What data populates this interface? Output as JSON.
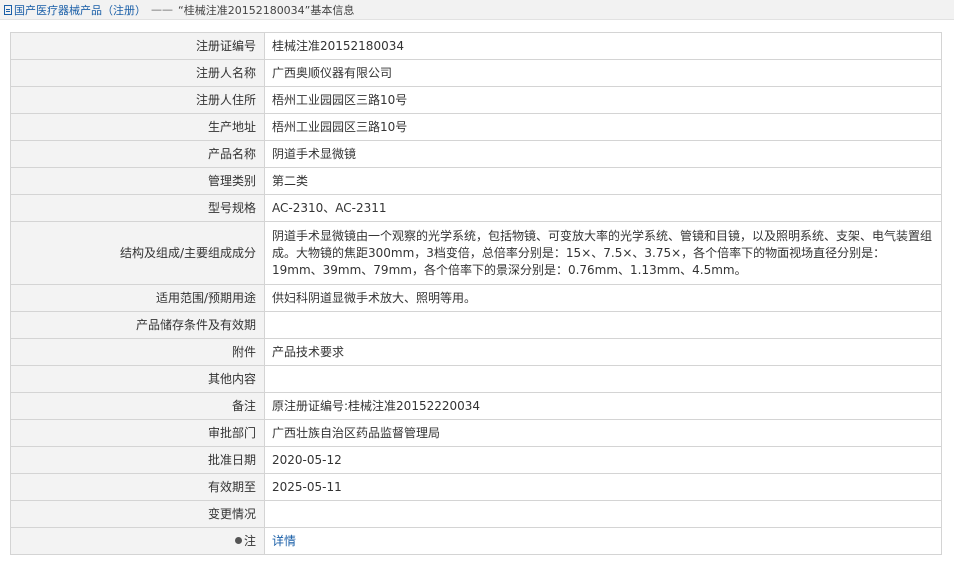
{
  "breadcrumb": {
    "root": "国产医疗器械产品（注册）",
    "separator": "——",
    "current": "“桂械注准20152180034”基本信息"
  },
  "rows": [
    {
      "label": "注册证编号",
      "value": "桂械注准20152180034"
    },
    {
      "label": "注册人名称",
      "value": "广西奥顺仪器有限公司"
    },
    {
      "label": "注册人住所",
      "value": "梧州工业园园区三路10号"
    },
    {
      "label": "生产地址",
      "value": "梧州工业园园区三路10号"
    },
    {
      "label": "产品名称",
      "value": "阴道手术显微镜"
    },
    {
      "label": "管理类别",
      "value": "第二类"
    },
    {
      "label": "型号规格",
      "value": "AC-2310、AC-2311"
    },
    {
      "label": "结构及组成/主要组成成分",
      "value": "阴道手术显微镜由一个观察的光学系统，包括物镜、可变放大率的光学系统、管镜和目镜，以及照明系统、支架、电气装置组成。大物镜的焦距300mm，3档变倍，总倍率分别是：15×、7.5×、3.75×，各个倍率下的物面视场直径分别是：19mm、39mm、79mm，各个倍率下的景深分别是：0.76mm、1.13mm、4.5mm。"
    },
    {
      "label": "适用范围/预期用途",
      "value": "供妇科阴道显微手术放大、照明等用。"
    },
    {
      "label": "产品储存条件及有效期",
      "value": ""
    },
    {
      "label": "附件",
      "value": "产品技术要求"
    },
    {
      "label": "其他内容",
      "value": ""
    },
    {
      "label": "备注",
      "value": "原注册证编号:桂械注准20152220034"
    },
    {
      "label": "审批部门",
      "value": "广西壮族自治区药品监督管理局"
    },
    {
      "label": "批准日期",
      "value": "2020-05-12"
    },
    {
      "label": "有效期至",
      "value": "2025-05-11"
    },
    {
      "label": "变更情况",
      "value": ""
    }
  ],
  "note": {
    "label": "注",
    "link": "详情"
  }
}
